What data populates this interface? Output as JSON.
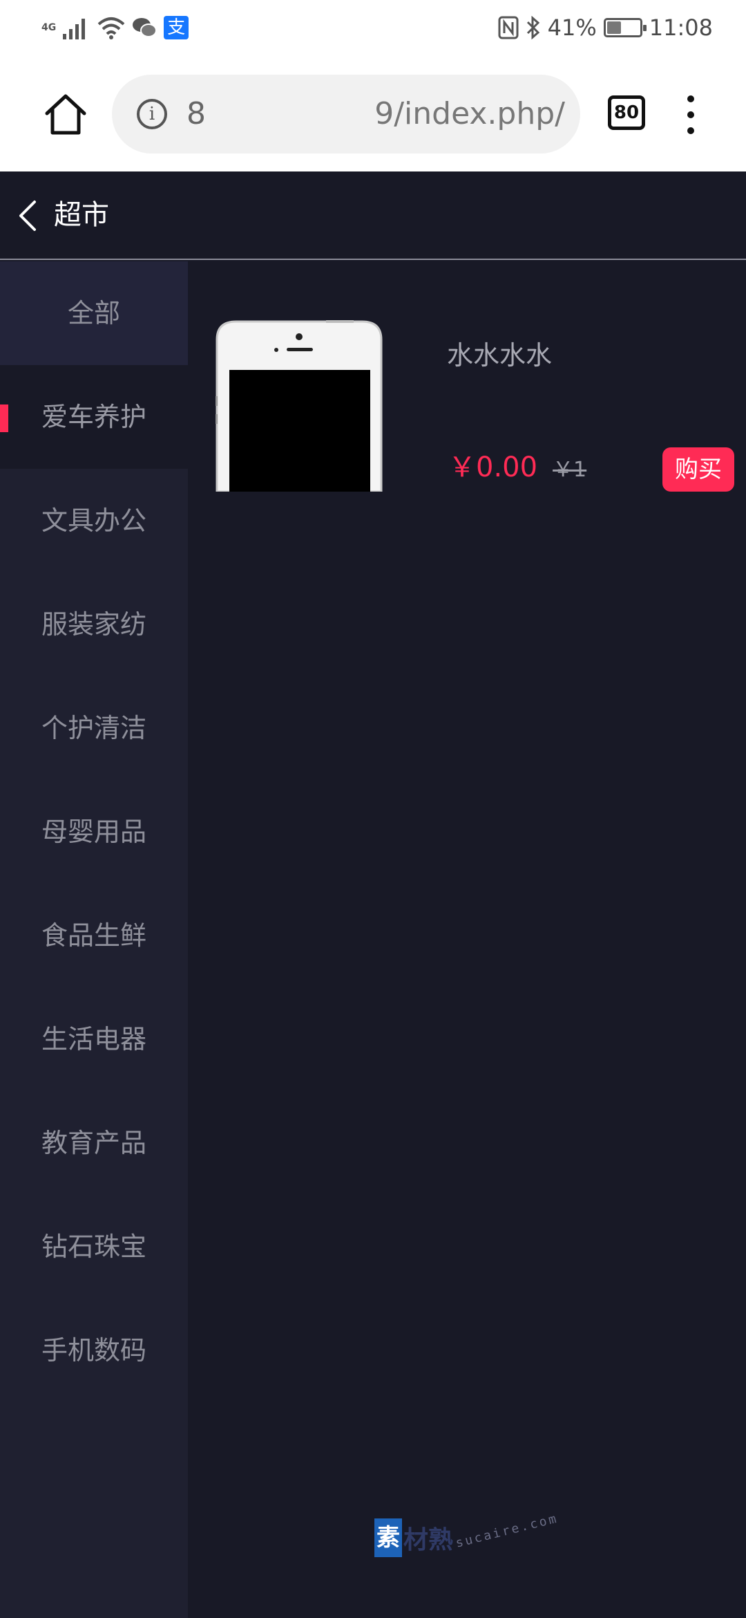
{
  "status_bar": {
    "network": "4G",
    "battery_percent": "41%",
    "battery_level": 0.41,
    "time": "11:08",
    "alipay_glyph": "支",
    "icons": [
      "signal-icon",
      "wifi-icon",
      "wechat-icon",
      "alipay-icon",
      "nfc-icon",
      "bluetooth-icon",
      "battery-icon"
    ]
  },
  "browser": {
    "url_start": "8",
    "url_visible": "9/index.php/",
    "info_glyph": "i",
    "tab_count": "80"
  },
  "header": {
    "title": "超市"
  },
  "sidebar": {
    "items": [
      {
        "label": "全部"
      },
      {
        "label": "爱车养护"
      },
      {
        "label": "文具办公"
      },
      {
        "label": "服装家纺"
      },
      {
        "label": "个护清洁"
      },
      {
        "label": "母婴用品"
      },
      {
        "label": "食品生鲜"
      },
      {
        "label": "生活电器"
      },
      {
        "label": "教育产品"
      },
      {
        "label": "钻石珠宝"
      },
      {
        "label": "手机数码"
      }
    ],
    "active_index": 1
  },
  "products": [
    {
      "name": "水水水水",
      "price": "￥0.00",
      "original_price": "￥1",
      "buy_label": "购买"
    }
  ],
  "watermark": {
    "logo_char": "素",
    "logo_rest": "材熟",
    "site": "sucaire.com"
  },
  "colors": {
    "accent": "#ff2b55",
    "background": "#181926",
    "sidebar": "#1f2030"
  }
}
